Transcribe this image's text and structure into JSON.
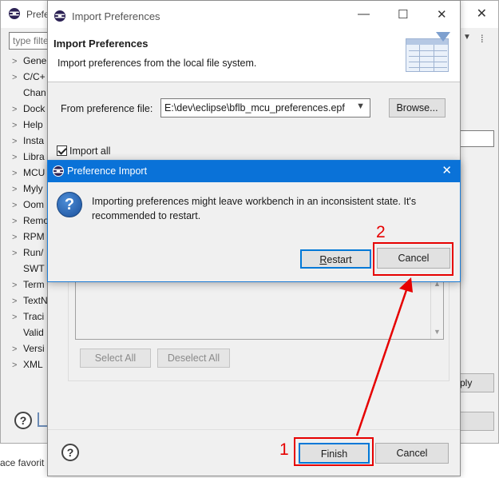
{
  "background_window": {
    "title": "Prefe",
    "filter_placeholder": "type filte",
    "tree_items": [
      {
        "label": "Gene",
        "expandable": true
      },
      {
        "label": "C/C+",
        "expandable": true
      },
      {
        "label": "Chan",
        "expandable": false
      },
      {
        "label": "Dock",
        "expandable": true
      },
      {
        "label": "Help",
        "expandable": true
      },
      {
        "label": "Insta",
        "expandable": true
      },
      {
        "label": "Libra",
        "expandable": true
      },
      {
        "label": "MCU",
        "expandable": true
      },
      {
        "label": "Myly",
        "expandable": true
      },
      {
        "label": "Oom",
        "expandable": true
      },
      {
        "label": "Remo",
        "expandable": true
      },
      {
        "label": "RPM",
        "expandable": true
      },
      {
        "label": "Run/",
        "expandable": true
      },
      {
        "label": "SWT",
        "expandable": false
      },
      {
        "label": "Term",
        "expandable": true
      },
      {
        "label": "TextN",
        "expandable": true
      },
      {
        "label": "Traci",
        "expandable": true
      },
      {
        "label": "Valid",
        "expandable": false
      },
      {
        "label": "Versi",
        "expandable": true
      },
      {
        "label": "XML",
        "expandable": true
      }
    ],
    "apply_label": "ply",
    "bottom_text": "ace favorit"
  },
  "wizard": {
    "title": "Import Preferences",
    "header_title": "Import Preferences",
    "header_description": "Import preferences from the local file system.",
    "from_label": "From preference file:",
    "file_path": "E:\\dev\\eclipse\\bflb_mcu_preferences.epf",
    "browse_label": "Browse...",
    "import_all_label": "Import all",
    "import_all_checked": true,
    "select_all_label": "Select All",
    "deselect_all_label": "Deselect All",
    "finish_label": "Finish",
    "cancel_label": "Cancel"
  },
  "dialog": {
    "title": "Preference Import",
    "message": "Importing preferences might leave workbench in an inconsistent state. It's recommended to restart.",
    "restart_label": "Restart",
    "cancel_label": "Cancel"
  },
  "annotations": {
    "step_1": "1",
    "step_2": "2",
    "highlight_color": "#e60000"
  },
  "colors": {
    "dialog_titlebar": "#0a72d8",
    "default_button_border": "#0078d7"
  }
}
